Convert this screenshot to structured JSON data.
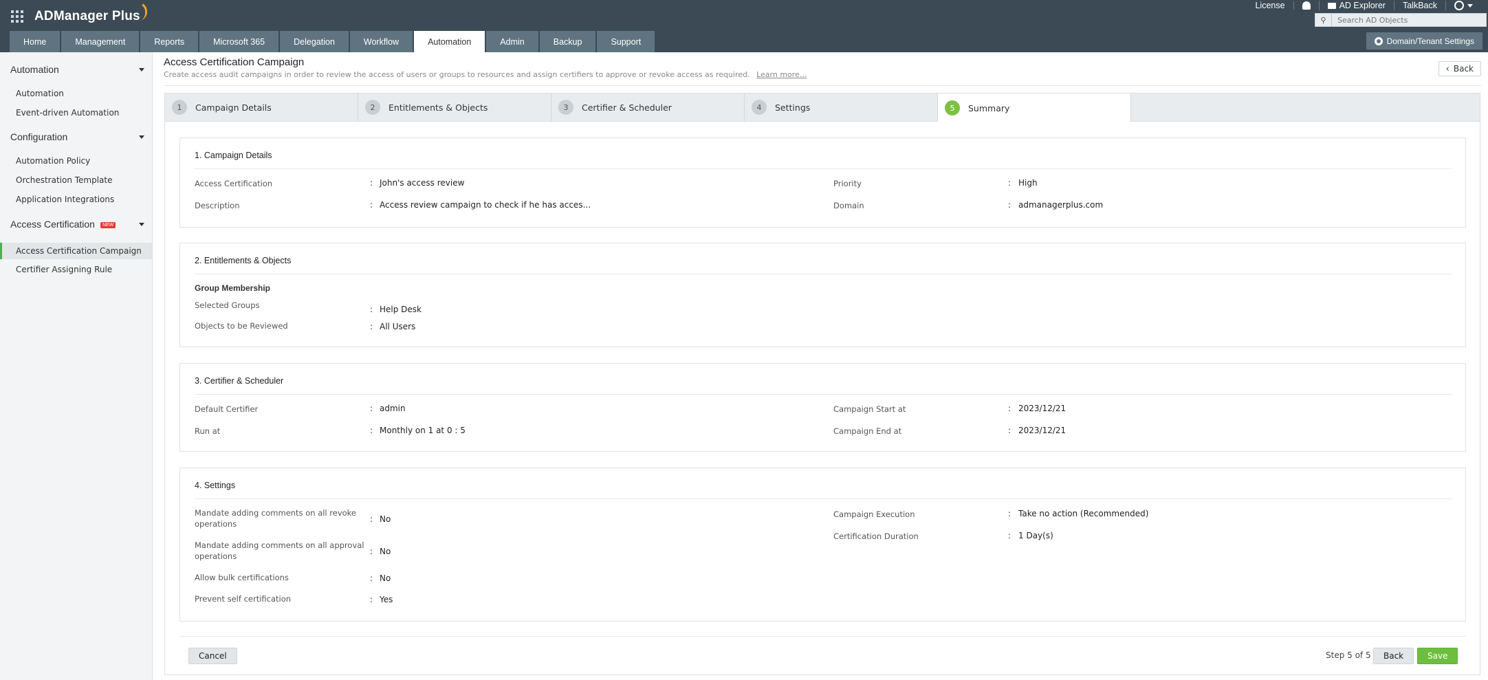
{
  "app": {
    "logo": "ADManager Plus",
    "top_links": {
      "license": "License",
      "ad_explorer": "AD Explorer",
      "talkback": "TalkBack"
    },
    "search_placeholder": "Search AD Objects",
    "tenant_settings": "Domain/Tenant Settings",
    "nav_tabs": [
      "Home",
      "Management",
      "Reports",
      "Microsoft 365",
      "Delegation",
      "Workflow",
      "Automation",
      "Admin",
      "Backup",
      "Support"
    ],
    "active_tab": "Automation"
  },
  "sidebar": {
    "sections": [
      {
        "title": "Automation",
        "items": [
          "Automation",
          "Event-driven Automation"
        ]
      },
      {
        "title": "Configuration",
        "items": [
          "Automation Policy",
          "Orchestration Template",
          "Application Integrations"
        ]
      },
      {
        "title": "Access Certification",
        "badge": "NEW",
        "items": [
          "Access Certification Campaign",
          "Certifier Assigning Rule"
        ]
      }
    ],
    "active_item": "Access Certification Campaign"
  },
  "page": {
    "title": "Access Certification Campaign",
    "subtitle": "Create access audit campaigns in order to review the access of users or groups to resources and assign certifiers to approve or revoke access as required.",
    "learn_more": "Learn more...",
    "back_label": "Back"
  },
  "steps": [
    {
      "num": "1",
      "label": "Campaign Details"
    },
    {
      "num": "2",
      "label": "Entitlements & Objects"
    },
    {
      "num": "3",
      "label": "Certifier & Scheduler"
    },
    {
      "num": "4",
      "label": "Settings"
    },
    {
      "num": "5",
      "label": "Summary"
    }
  ],
  "summary": {
    "campaign": {
      "title": "1. Campaign Details",
      "access_certification_label": "Access Certification",
      "access_certification_value": "John's access review",
      "description_label": "Description",
      "description_value": "Access review campaign to check if he has acces...",
      "priority_label": "Priority",
      "priority_value": "High",
      "domain_label": "Domain",
      "domain_value": "admanagerplus.com"
    },
    "entitlements": {
      "title": "2. Entitlements & Objects",
      "group_membership": "Group Membership",
      "selected_groups_label": "Selected Groups",
      "selected_groups_value": "Help Desk",
      "objects_label": "Objects to be Reviewed",
      "objects_value": "All Users"
    },
    "certifier": {
      "title": "3. Certifier & Scheduler",
      "default_certifier_label": "Default Certifier",
      "default_certifier_value": "admin",
      "run_at_label": "Run at",
      "run_at_value": "Monthly on 1 at 0 : 5",
      "start_label": "Campaign Start at",
      "start_value": "2023/12/21",
      "end_label": "Campaign End at",
      "end_value": "2023/12/21"
    },
    "settings": {
      "title": "4. Settings",
      "revoke_label_1": "Mandate adding comments on all revoke",
      "revoke_label_2": "operations",
      "revoke_value": "No",
      "approval_label_1": "Mandate adding comments on all approval",
      "approval_label_2": "operations",
      "approval_value": "No",
      "bulk_label": "Allow bulk certifications",
      "bulk_value": "No",
      "self_label": "Prevent self certification",
      "self_value": "Yes",
      "execution_label": "Campaign Execution",
      "execution_value": "Take no action (Recommended)",
      "duration_label": "Certification Duration",
      "duration_value": "1 Day(s)"
    }
  },
  "footer": {
    "cancel": "Cancel",
    "step_count": "Step 5 of 5",
    "back": "Back",
    "save": "Save"
  },
  "colors": {
    "header_bg": "#3b4a54",
    "tab_bg": "#5f7480",
    "accent_green": "#6cbf3e"
  }
}
